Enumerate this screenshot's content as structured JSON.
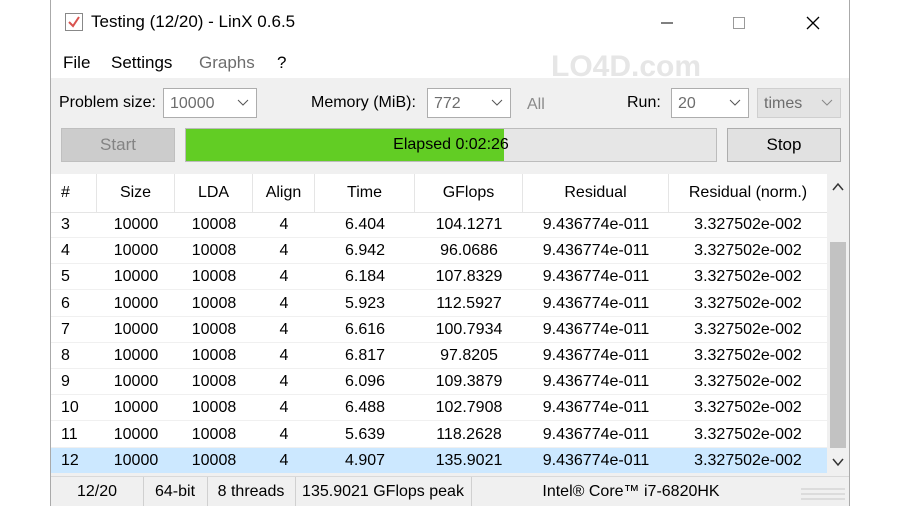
{
  "window": {
    "title": "Testing (12/20) - LinX 0.6.5",
    "icon": "checkbox-check-icon",
    "controls": {
      "minimize": "minimize-icon",
      "maximize": "maximize-icon",
      "close": "close-icon"
    }
  },
  "menu": {
    "file": "File",
    "settings": "Settings",
    "graphs": "Graphs",
    "help": "?"
  },
  "watermark": "LO4D.com",
  "options": {
    "problem_size_label": "Problem size:",
    "problem_size_value": "10000",
    "memory_label": "Memory (MiB):",
    "memory_value": "772",
    "all_label": "All",
    "run_label": "Run:",
    "run_value": "20",
    "run_unit": "times"
  },
  "controls": {
    "start_label": "Start",
    "stop_label": "Stop",
    "elapsed_text": "Elapsed 0:02:26",
    "progress_fraction": 0.6
  },
  "table": {
    "headers": [
      "#",
      "Size",
      "LDA",
      "Align",
      "Time",
      "GFlops",
      "Residual",
      "Residual (norm.)"
    ],
    "rows": [
      [
        "3",
        "10000",
        "10008",
        "4",
        "6.404",
        "104.1271",
        "9.436774e-011",
        "3.327502e-002"
      ],
      [
        "4",
        "10000",
        "10008",
        "4",
        "6.942",
        "96.0686",
        "9.436774e-011",
        "3.327502e-002"
      ],
      [
        "5",
        "10000",
        "10008",
        "4",
        "6.184",
        "107.8329",
        "9.436774e-011",
        "3.327502e-002"
      ],
      [
        "6",
        "10000",
        "10008",
        "4",
        "5.923",
        "112.5927",
        "9.436774e-011",
        "3.327502e-002"
      ],
      [
        "7",
        "10000",
        "10008",
        "4",
        "6.616",
        "100.7934",
        "9.436774e-011",
        "3.327502e-002"
      ],
      [
        "8",
        "10000",
        "10008",
        "4",
        "6.817",
        "97.8205",
        "9.436774e-011",
        "3.327502e-002"
      ],
      [
        "9",
        "10000",
        "10008",
        "4",
        "6.096",
        "109.3879",
        "9.436774e-011",
        "3.327502e-002"
      ],
      [
        "10",
        "10000",
        "10008",
        "4",
        "6.488",
        "102.7908",
        "9.436774e-011",
        "3.327502e-002"
      ],
      [
        "11",
        "10000",
        "10008",
        "4",
        "5.639",
        "118.2628",
        "9.436774e-011",
        "3.327502e-002"
      ],
      [
        "12",
        "10000",
        "10008",
        "4",
        "4.907",
        "135.9021",
        "9.436774e-011",
        "3.327502e-002"
      ]
    ],
    "selected_row": "12"
  },
  "status": {
    "progress": "12/20",
    "arch": "64-bit",
    "threads": "8 threads",
    "peak": "135.9021 GFlops peak",
    "cpu": "Intel® Core™ i7-6820HK"
  },
  "colors": {
    "progress_fill": "#62cd24",
    "selected_row": "#cce8ff",
    "title_icon_check": "#d9534f"
  }
}
